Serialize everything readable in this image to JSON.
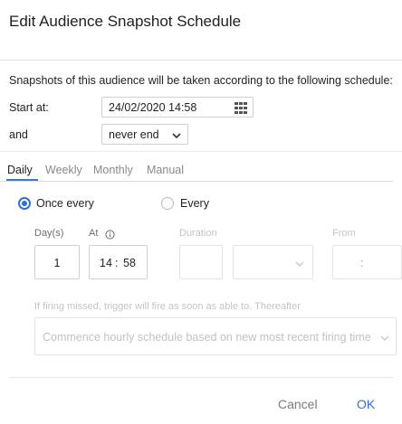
{
  "dialog": {
    "title": "Edit Audience Snapshot Schedule",
    "description": "Snapshots of this audience will be taken according to the following schedule:",
    "start_label": "Start at:",
    "start_value": "24/02/2020 14:58",
    "end_label": "and",
    "end_value": "never end"
  },
  "tabs": [
    {
      "label": "Daily",
      "active": true
    },
    {
      "label": "Weekly",
      "active": false
    },
    {
      "label": "Monthly",
      "active": false
    },
    {
      "label": "Manual",
      "active": false
    }
  ],
  "daily": {
    "option_once_label": "Once every",
    "option_once_selected": true,
    "option_every_label": "Every",
    "option_every_selected": false,
    "days_label": "Day(s)",
    "days_value": "1",
    "at_label": "At",
    "at_hour": "14",
    "at_sep": ":",
    "at_minute": "58",
    "duration_label": "Duration",
    "duration_value": "",
    "duration_unit_value": "",
    "from_label": "From",
    "from_value": ":"
  },
  "missed": {
    "note": "If firing missed, trigger will fire as soon as able to. Thereafter",
    "option_value": "Commence hourly schedule based on new most recent firing time"
  },
  "footer": {
    "cancel_label": "Cancel",
    "ok_label": "OK"
  },
  "colors": {
    "accent": "#2f6fe0",
    "tab_underline": "#3a7bd5",
    "disabled_text": "#c4c4c4"
  }
}
